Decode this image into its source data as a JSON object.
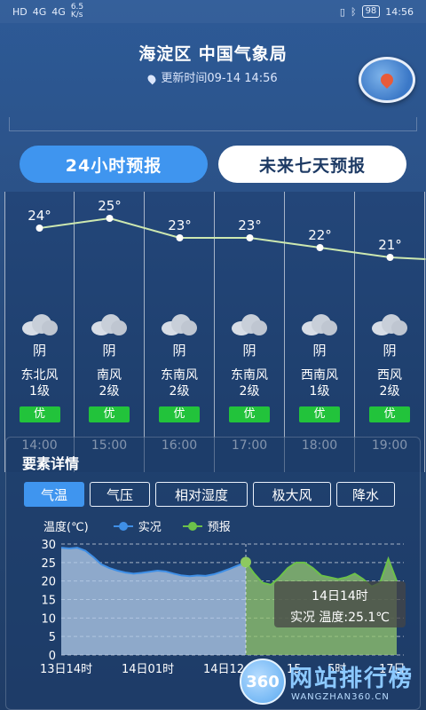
{
  "status_bar": {
    "left_indicators": [
      "HD",
      "4G",
      "4G"
    ],
    "speed": "6.5\nK/s",
    "battery": "98",
    "time": "14:56"
  },
  "header": {
    "title": "海淀区 中国气象局",
    "updated": "更新时间09-14 14:56"
  },
  "tabs": [
    {
      "label": "24小时预报",
      "active": true
    },
    {
      "label": "未来七天预报",
      "active": false
    }
  ],
  "hourly": [
    {
      "temp": "24°",
      "temp_value": 24,
      "condition": "阴",
      "wind_dir": "东北风",
      "wind_level": "1级",
      "aqi": "优",
      "time": "14:00"
    },
    {
      "temp": "25°",
      "temp_value": 25,
      "condition": "阴",
      "wind_dir": "南风",
      "wind_level": "2级",
      "aqi": "优",
      "time": "15:00"
    },
    {
      "temp": "23°",
      "temp_value": 23,
      "condition": "阴",
      "wind_dir": "东南风",
      "wind_level": "2级",
      "aqi": "优",
      "time": "16:00"
    },
    {
      "temp": "23°",
      "temp_value": 23,
      "condition": "阴",
      "wind_dir": "东南风",
      "wind_level": "2级",
      "aqi": "优",
      "time": "17:00"
    },
    {
      "temp": "22°",
      "temp_value": 22,
      "condition": "阴",
      "wind_dir": "西南风",
      "wind_level": "1级",
      "aqi": "优",
      "time": "18:00"
    },
    {
      "temp": "21°",
      "temp_value": 21,
      "condition": "阴",
      "wind_dir": "西风",
      "wind_level": "2级",
      "aqi": "优",
      "time": "19:00"
    }
  ],
  "details": {
    "title": "要素详情",
    "tabs": [
      {
        "label": "气温",
        "active": true
      },
      {
        "label": "气压",
        "active": false
      },
      {
        "label": "相对湿度",
        "active": false
      },
      {
        "label": "极大风",
        "active": false
      },
      {
        "label": "降水",
        "active": false
      }
    ],
    "ylabel": "温度(℃)",
    "legend_actual": "实况",
    "legend_forecast": "预报",
    "tooltip_time": "14日14时",
    "tooltip_value": "实况 温度:25.1℃"
  },
  "colors": {
    "accent": "#3f95ef",
    "actual_line": "#3f8fe6",
    "forecast_line": "#6cc14a",
    "aqi_good": "#22c33b",
    "temp_line": "#cde8b0"
  },
  "chart_data": {
    "type": "area",
    "ylim": [
      0,
      30
    ],
    "yticks": [
      0,
      5,
      10,
      15,
      20,
      25,
      30
    ],
    "xtick_labels": [
      "13日14时",
      "14日01时",
      "14日12",
      "15",
      "5时",
      "17日"
    ],
    "series": [
      {
        "name": "实况",
        "points": [
          29,
          28.8,
          29,
          28.2,
          26.5,
          24.5,
          23.5,
          22.8,
          22.3,
          22,
          22.2,
          22.5,
          22.8,
          22.6,
          22,
          21.5,
          21.3,
          21.5,
          21.4,
          21.8,
          22.5,
          23.3,
          24.2,
          25.1
        ]
      },
      {
        "name": "预报",
        "points": [
          25.1,
          22,
          19.5,
          19,
          21,
          23.5,
          25,
          25,
          23.5,
          21.5,
          21,
          20.5,
          21,
          22,
          20.5,
          18.5,
          19.5,
          26,
          20
        ]
      }
    ]
  },
  "watermark": {
    "badge": "360",
    "text": "网站排行榜",
    "sub": "WANGZHAN360.CN"
  }
}
